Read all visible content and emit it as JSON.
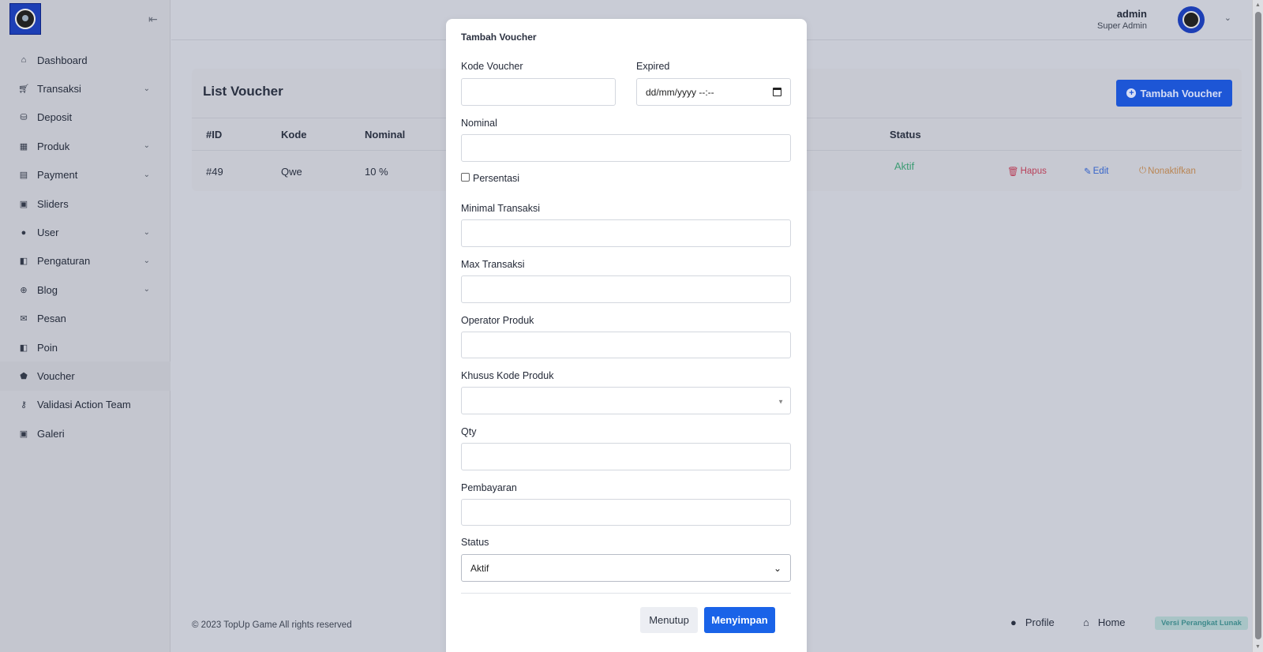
{
  "sidebar": {
    "items": [
      {
        "label": "Dashboard",
        "icon": "home-icon",
        "has_submenu": false
      },
      {
        "label": "Transaksi",
        "icon": "cart-icon",
        "has_submenu": true
      },
      {
        "label": "Deposit",
        "icon": "coins-icon",
        "has_submenu": false
      },
      {
        "label": "Produk",
        "icon": "store-icon",
        "has_submenu": true
      },
      {
        "label": "Payment",
        "icon": "wallet-icon",
        "has_submenu": true
      },
      {
        "label": "Sliders",
        "icon": "image-icon",
        "has_submenu": false
      },
      {
        "label": "User",
        "icon": "user-icon",
        "has_submenu": true
      },
      {
        "label": "Pengaturan",
        "icon": "settings-icon",
        "has_submenu": true
      },
      {
        "label": "Blog",
        "icon": "globe-icon",
        "has_submenu": true
      },
      {
        "label": "Pesan",
        "icon": "mail-icon",
        "has_submenu": false
      },
      {
        "label": "Poin",
        "icon": "points-icon",
        "has_submenu": false
      },
      {
        "label": "Voucher",
        "icon": "tags-icon",
        "has_submenu": false,
        "active": true
      },
      {
        "label": "Validasi Action Team",
        "icon": "key-icon",
        "has_submenu": false
      },
      {
        "label": "Galeri",
        "icon": "gallery-icon",
        "has_submenu": false
      }
    ]
  },
  "header": {
    "user_name": "admin",
    "user_role": "Super Admin"
  },
  "card": {
    "title": "List Voucher",
    "add_button": "Tambah Voucher",
    "columns": [
      "#ID",
      "Kode",
      "Nominal",
      "Status"
    ],
    "row": {
      "id": "#49",
      "kode": "Qwe",
      "nominal": "10 %",
      "status": "Aktif",
      "actions": {
        "delete": "Hapus",
        "edit": "Edit",
        "deactivate": "Nonaktifkan"
      }
    }
  },
  "footer": {
    "copyright": "© 2023 TopUp Game All rights reserved",
    "profile": "Profile",
    "home": "Home",
    "version": "Versi Perangkat Lunak"
  },
  "modal": {
    "title": "Tambah Voucher",
    "fields": {
      "kode_voucher": {
        "label": "Kode Voucher",
        "value": ""
      },
      "expired": {
        "label": "Expired",
        "placeholder": "dd/mm/yyyy  --:--"
      },
      "nominal": {
        "label": "Nominal",
        "value": ""
      },
      "persentasi": {
        "label": "Persentasi",
        "checked": false
      },
      "minimal_transaksi": {
        "label": "Minimal Transaksi",
        "value": ""
      },
      "max_transaksi": {
        "label": "Max Transaksi",
        "value": ""
      },
      "operator_produk": {
        "label": "Operator Produk",
        "value": ""
      },
      "khusus_kode_produk": {
        "label": "Khusus Kode Produk",
        "value": ""
      },
      "qty": {
        "label": "Qty",
        "value": ""
      },
      "pembayaran": {
        "label": "Pembayaran",
        "value": ""
      },
      "status": {
        "label": "Status",
        "value": "Aktif"
      }
    },
    "buttons": {
      "close": "Menutup",
      "save": "Menyimpan"
    }
  },
  "colors": {
    "primary": "#1a63e8",
    "status_active": "#3d9c74",
    "delete": "#b8405a",
    "deactivate": "#b98553"
  }
}
